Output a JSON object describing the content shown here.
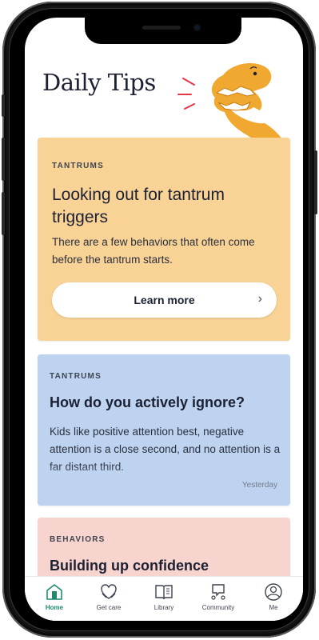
{
  "header": {
    "title": "Daily Tips"
  },
  "cards": [
    {
      "category": "TANTRUMS",
      "title": "Looking out for tantrum triggers",
      "body": "There are a few behaviors that often come before the tantrum starts.",
      "button_label": "Learn more",
      "background": "#f9d396"
    },
    {
      "category": "TANTRUMS",
      "title": "How do you actively ignore?",
      "body": "Kids like positive attention best, negative attention is a close second, and no attention is a far distant third.",
      "timestamp": "Yesterday",
      "background": "#bed3f0"
    },
    {
      "category": "BEHAVIORS",
      "title": "Building up confidence",
      "background": "#f8d4cf"
    }
  ],
  "tabs": [
    {
      "label": "Home",
      "icon": "home-icon",
      "active": true
    },
    {
      "label": "Get care",
      "icon": "heart-hands-icon",
      "active": false
    },
    {
      "label": "Library",
      "icon": "book-icon",
      "active": false
    },
    {
      "label": "Community",
      "icon": "community-icon",
      "active": false
    },
    {
      "label": "Me",
      "icon": "profile-icon",
      "active": false
    }
  ],
  "colors": {
    "accent": "#1f8a70",
    "dino": "#f0a830",
    "text": "#1c2033"
  }
}
